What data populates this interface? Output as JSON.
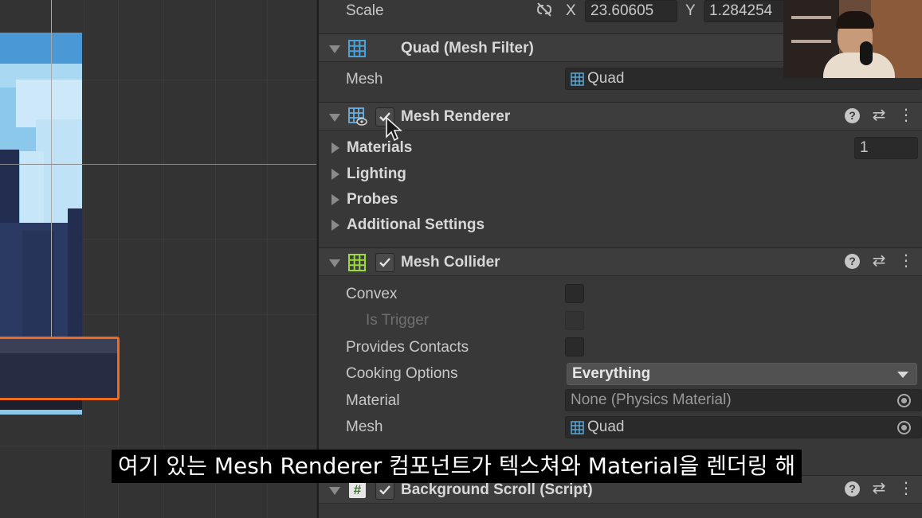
{
  "inspector": {
    "scale": {
      "label": "Scale",
      "x_label": "X",
      "x_value": "23.60605",
      "y_label": "Y",
      "y_value": "1.284254"
    },
    "mesh_filter": {
      "title": "Quad (Mesh Filter)",
      "mesh_label": "Mesh",
      "mesh_value": "Quad"
    },
    "mesh_renderer": {
      "title": "Mesh Renderer",
      "enabled": true,
      "sections": [
        "Materials",
        "Lighting",
        "Probes",
        "Additional Settings"
      ],
      "materials_count": "1"
    },
    "mesh_collider": {
      "title": "Mesh Collider",
      "enabled": true,
      "convex_label": "Convex",
      "is_trigger_label": "Is Trigger",
      "provides_contacts_label": "Provides Contacts",
      "cooking_options_label": "Cooking Options",
      "cooking_options_value": "Everything",
      "material_label": "Material",
      "material_value": "None (Physics Material)",
      "mesh_label": "Mesh",
      "mesh_value": "Quad"
    },
    "background_scroll": {
      "title": "Background Scroll (Script)",
      "enabled": true
    }
  },
  "subtitle": "여기 있는 Mesh Renderer 컴포넌트가 텍스쳐와 Material을 렌더링 해",
  "colors": {
    "selection_outline": "#f26a1b",
    "inspector_bg": "#383838",
    "scene_bg": "#333333",
    "mesh_filter_icon": "#4aa3d8",
    "mesh_collider_icon": "#9bdc3b",
    "script_icon": "#8fd16a"
  },
  "icons": [
    "unlink-icon",
    "mesh-filter-icon",
    "mesh-renderer-icon",
    "mesh-collider-icon",
    "script-icon",
    "help-icon",
    "presets-icon",
    "kebab-menu-icon",
    "object-picker-icon",
    "dropdown-arrow-icon",
    "mouse-cursor-icon"
  ]
}
